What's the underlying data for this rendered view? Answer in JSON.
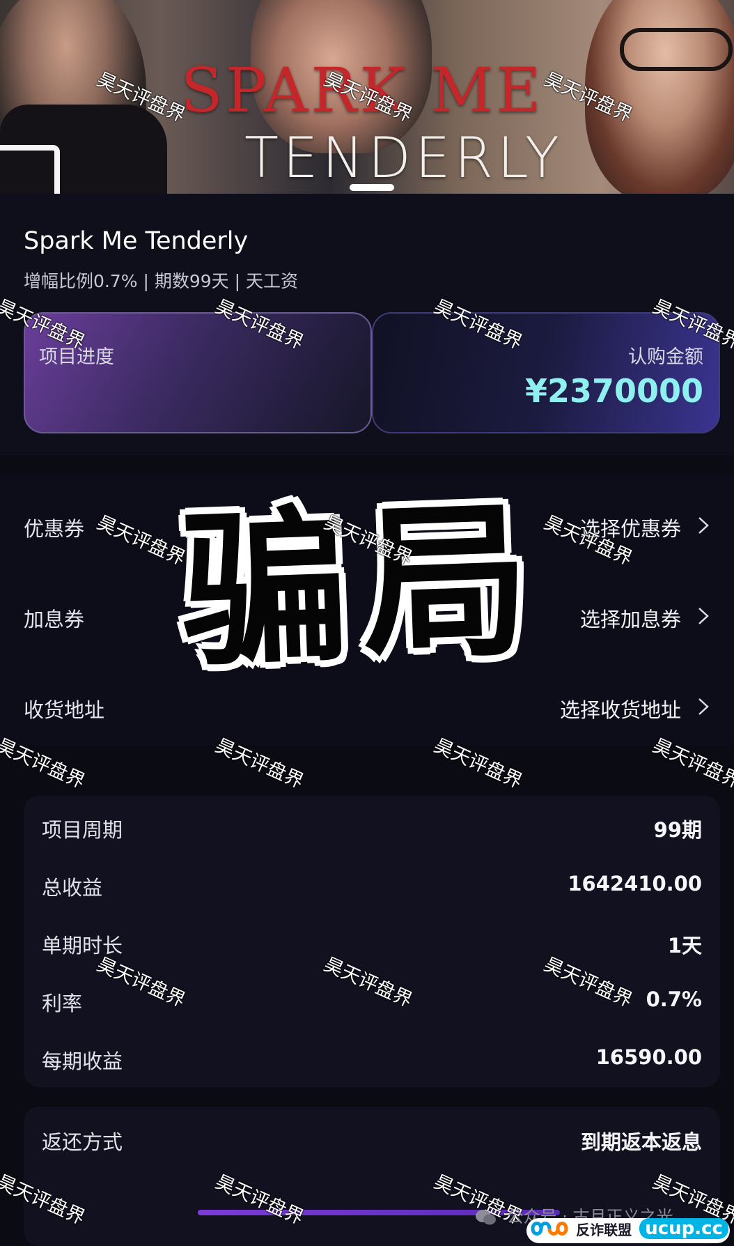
{
  "banner": {
    "title_line1": "SPARK ME",
    "title_line2": "TENDERLY"
  },
  "product": {
    "name": "Spark Me Tenderly",
    "meta": "增幅比例0.7% | 期数99天 | 天工资",
    "progress_label": "项目进度",
    "amount_label": "认购金额",
    "amount_value": "¥2370000"
  },
  "selections": [
    {
      "label": "优惠券",
      "action": "选择优惠券"
    },
    {
      "label": "加息券",
      "action": "选择加息券"
    },
    {
      "label": "收货地址",
      "action": "选择收货地址"
    }
  ],
  "details": [
    {
      "label": "项目周期",
      "value": "99期"
    },
    {
      "label": "总收益",
      "value": "1642410.00"
    },
    {
      "label": "单期时长",
      "value": "1天"
    },
    {
      "label": "利率",
      "value": "0.7%"
    },
    {
      "label": "每期收益",
      "value": "16590.00"
    }
  ],
  "return_method": {
    "label": "返还方式",
    "value": "到期返本返息"
  },
  "overlay_stamp": "骗局",
  "watermark_text": "昊天评盘界",
  "footer": {
    "wechat_text": "公众号 · 古月正义之光",
    "brand_cn": "反诈联盟",
    "brand_en": "ucup.cc"
  },
  "colors": {
    "amount_value": "#8ff0f0",
    "card_progress": "#6a3e9a",
    "card_amount": "#3b3490",
    "page_background": "#0b0b14"
  }
}
